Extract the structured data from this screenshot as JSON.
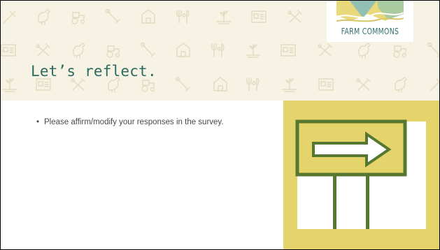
{
  "slide": {
    "title": "Let’s reflect.",
    "bullets": [
      "Please affirm/modify your responses in the survey."
    ]
  },
  "logo": {
    "text": "FARM COMMONS"
  },
  "illustration": {
    "icon": "arrow-sign-icon"
  },
  "header": {
    "pattern_icons": [
      "carrot-icon",
      "chicken-icon",
      "tractor-icon",
      "wrench-icon",
      "barn-icon",
      "fork-knife-icon",
      "plant-icon",
      "document-icon",
      "tools-icon"
    ]
  },
  "colors": {
    "header_bg": "#f6f3e4",
    "title": "#2d6a62",
    "panel_bg": "#e5d46b",
    "sign_green": "#56772f",
    "logo_text": "#2f6f6a"
  }
}
